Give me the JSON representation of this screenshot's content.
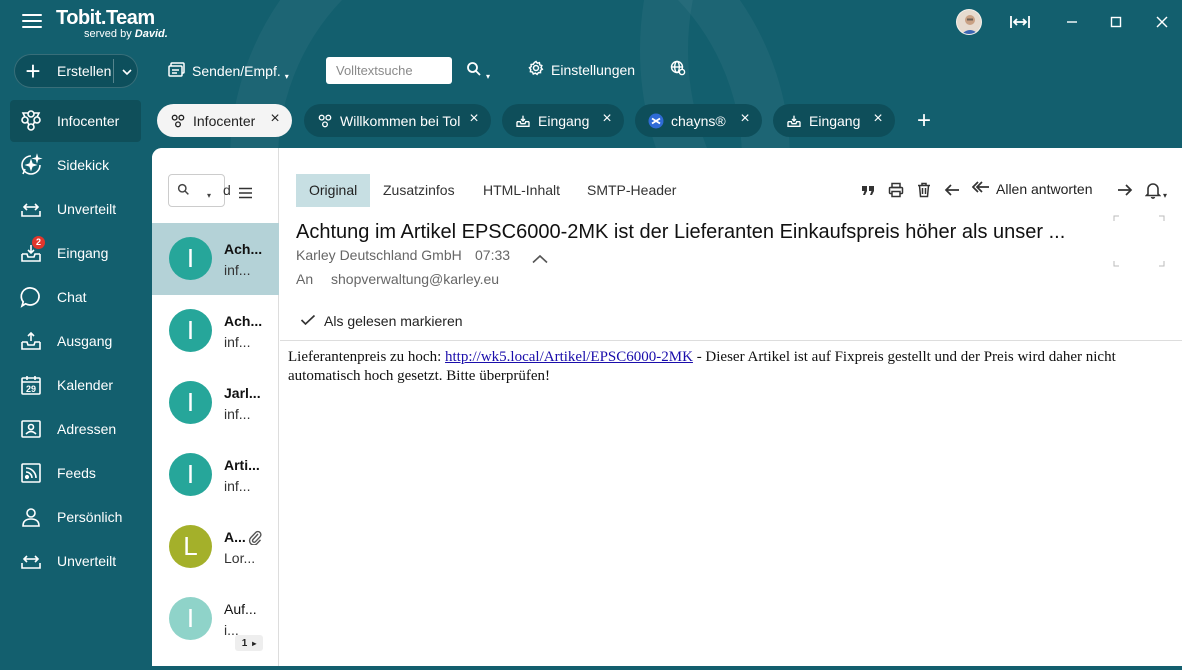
{
  "app": {
    "title": "Tobit.Team",
    "subtitle": "served by",
    "subtitle_brand": "David."
  },
  "toolbar": {
    "create_label": "Erstellen",
    "send_receive_label": "Senden/Empf.",
    "search_placeholder": "Volltextsuche",
    "settings_label": "Einstellungen"
  },
  "sidebar": {
    "items": [
      {
        "label": "Infocenter",
        "icon": "infocenter-icon",
        "active": true
      },
      {
        "label": "Sidekick",
        "icon": "sidekick-icon"
      },
      {
        "label": "Unverteilt",
        "icon": "unassigned-icon"
      },
      {
        "label": "Eingang",
        "icon": "inbox-icon",
        "badge": "2"
      },
      {
        "label": "Chat",
        "icon": "chat-icon"
      },
      {
        "label": "Ausgang",
        "icon": "outbox-icon"
      },
      {
        "label": "Kalender",
        "icon": "calendar-icon",
        "icon_text": "29"
      },
      {
        "label": "Adressen",
        "icon": "contacts-icon"
      },
      {
        "label": "Feeds",
        "icon": "feeds-icon"
      },
      {
        "label": "Persönlich",
        "icon": "person-icon"
      },
      {
        "label": "Unverteilt",
        "icon": "unassigned-icon"
      }
    ]
  },
  "tabs": [
    {
      "label": "Infocenter",
      "icon": "infocenter-icon",
      "active": true
    },
    {
      "label": "Willkommen bei Tol",
      "icon": "infocenter-icon"
    },
    {
      "label": "Eingang",
      "icon": "inbox-icon"
    },
    {
      "label": "chayns®",
      "icon": "chayns-icon"
    },
    {
      "label": "Eingang",
      "icon": "inbox-icon"
    }
  ],
  "list": {
    "search_suffix": "d",
    "items": [
      {
        "initial": "I",
        "title": "Ach...",
        "subtitle": "inf...",
        "color": "#26a69a",
        "selected": true
      },
      {
        "initial": "I",
        "title": "Ach...",
        "subtitle": "inf...",
        "color": "#26a69a"
      },
      {
        "initial": "I",
        "title": "Jarl...",
        "subtitle": "inf...",
        "color": "#26a69a"
      },
      {
        "initial": "I",
        "title": "Arti...",
        "subtitle": "inf...",
        "color": "#26a69a"
      },
      {
        "initial": "L",
        "title": "A...",
        "subtitle": "Lor...",
        "color": "#a4b02a",
        "attachment": true
      },
      {
        "initial": "I",
        "title": "Auf...",
        "subtitle": "i...",
        "color": "#8fd3c9"
      }
    ],
    "pager": "1"
  },
  "mail": {
    "tabs": [
      "Original",
      "Zusatzinfos",
      "HTML-Inhalt",
      "SMTP-Header"
    ],
    "reply_all_label": "Allen antworten",
    "subject": "Achtung im Artikel EPSC6000-2MK ist der Lieferanten Einkaufspreis höher als unser ...",
    "sender": "Karley Deutschland GmbH",
    "time": "07:33",
    "to_label": "An",
    "to_value": "shopverwaltung@karley.eu",
    "mark_read_label": "Als gelesen markieren",
    "body_prefix": "Lieferantenpreis zu hoch: ",
    "body_link": "http://wk5.local/Artikel/EPSC6000-2MK",
    "body_suffix": " - Dieser Artikel ist auf Fixpreis gestellt und der Preis wird daher nicht automatisch hoch gesetzt. Bitte überprüfen!"
  },
  "colors": {
    "background": "#135f6e",
    "accent_selected": "#b4d2d7",
    "badge": "#e0362c"
  }
}
